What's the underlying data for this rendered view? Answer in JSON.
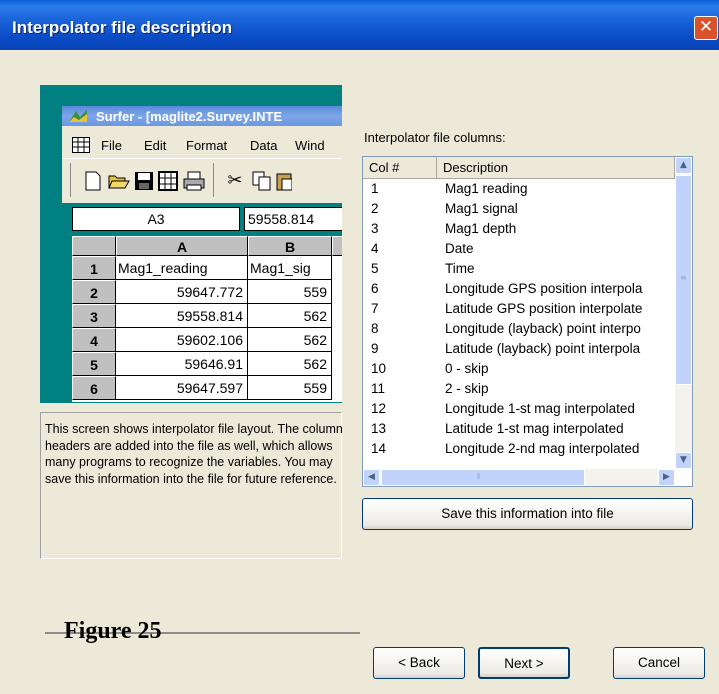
{
  "dialog": {
    "title": "Interpolator file description",
    "close_glyph": "✕"
  },
  "surfer": {
    "title": "Surfer - [maglite2.Survey.INTE",
    "menu": [
      "File",
      "Edit",
      "Format",
      "Data",
      "Wind"
    ],
    "cell_ref": "A3",
    "cell_value": "59558.814",
    "columns": [
      "A",
      "B"
    ],
    "rows": [
      {
        "num": "1",
        "a": "Mag1_reading",
        "b": "Mag1_sig"
      },
      {
        "num": "2",
        "a": "59647.772",
        "b": "559"
      },
      {
        "num": "3",
        "a": "59558.814",
        "b": "562"
      },
      {
        "num": "4",
        "a": "59602.106",
        "b": "562"
      },
      {
        "num": "5",
        "a": "59646.91",
        "b": "562"
      },
      {
        "num": "6",
        "a": "59647.597",
        "b": "559"
      }
    ]
  },
  "description": "This screen shows interpolator file layout. The column headers are added into the file as well, which allows many programs to recognize the variables. You may save this information into the file for future reference.",
  "columns_list": {
    "label": "Interpolator file columns:",
    "header_col": "Col #",
    "header_desc": "Description",
    "rows": [
      {
        "col": "1",
        "desc": "Mag1 reading"
      },
      {
        "col": "2",
        "desc": "Mag1 signal"
      },
      {
        "col": "3",
        "desc": "Mag1 depth"
      },
      {
        "col": "4",
        "desc": "Date"
      },
      {
        "col": "5",
        "desc": "Time"
      },
      {
        "col": "6",
        "desc": "Longitude GPS position interpola"
      },
      {
        "col": "7",
        "desc": "Latitude  GPS position interpolate"
      },
      {
        "col": "8",
        "desc": "Longitude (layback) point interpo"
      },
      {
        "col": "9",
        "desc": "Latitude  (layback) point interpola"
      },
      {
        "col": "10",
        "desc": "0 - skip"
      },
      {
        "col": "11",
        "desc": "2 - skip"
      },
      {
        "col": "12",
        "desc": "Longitude 1-st mag interpolated"
      },
      {
        "col": "13",
        "desc": "Latitude  1-st mag interpolated"
      },
      {
        "col": "14",
        "desc": "Longitude 2-nd mag interpolated"
      }
    ]
  },
  "buttons": {
    "save": "Save this information into file",
    "back": "< Back",
    "next": "Next >",
    "cancel": "Cancel"
  },
  "figure_caption": "Figure 25"
}
